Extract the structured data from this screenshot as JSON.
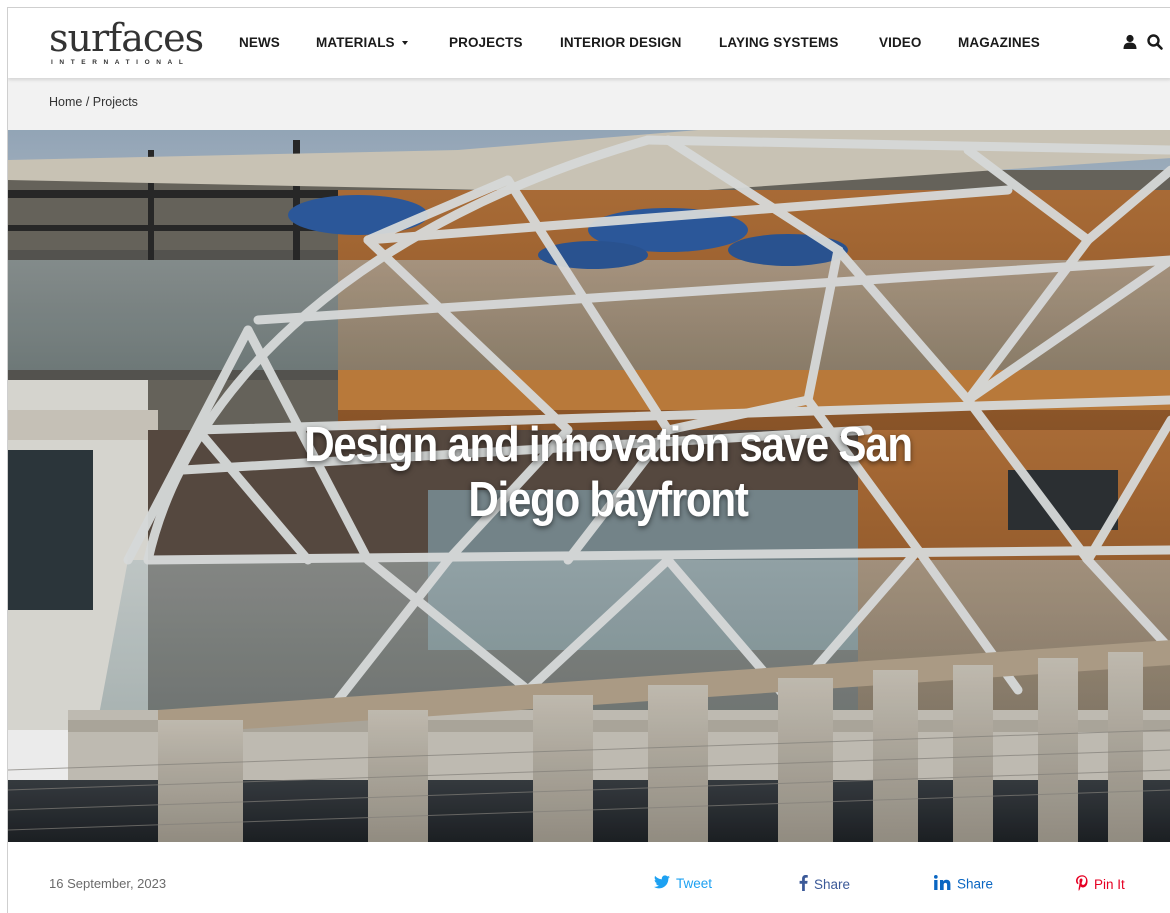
{
  "brand": {
    "logo_word": "surfaces",
    "logo_sub": "INTERNATIONAL"
  },
  "nav": {
    "items": [
      {
        "label": "NEWS"
      },
      {
        "label": "MATERIALS"
      },
      {
        "label": "PROJECTS"
      },
      {
        "label": "INTERIOR DESIGN"
      },
      {
        "label": "LAYING SYSTEMS"
      },
      {
        "label": "VIDEO"
      },
      {
        "label": "MAGAZINES"
      }
    ],
    "icons": [
      "user-icon",
      "search-icon"
    ]
  },
  "breadcrumb": {
    "home": "Home",
    "separator": " / ",
    "current": "Projects"
  },
  "article": {
    "title_line1": "Design and innovation save San",
    "title_line2": "Diego bayfront",
    "date": "16 September, 2023"
  },
  "share": {
    "twitter": {
      "label": "Tweet",
      "color": "#1da1f2",
      "icon": "twitter-icon"
    },
    "facebook": {
      "label": "Share",
      "color": "#3b5998",
      "icon": "facebook-icon"
    },
    "linkedin": {
      "label": "Share",
      "color": "#0a66c2",
      "icon": "linkedin-icon"
    },
    "pinterest": {
      "label": "Pin It",
      "color": "#e60023",
      "icon": "pinterest-icon"
    }
  }
}
